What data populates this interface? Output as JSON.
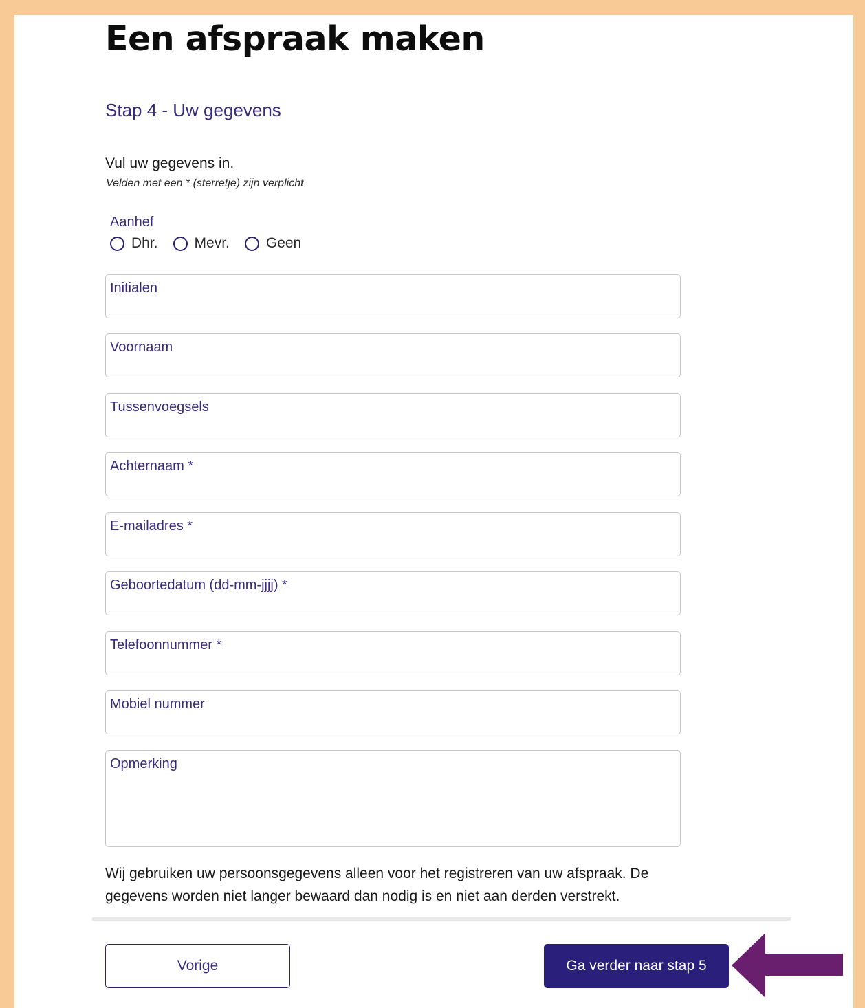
{
  "page": {
    "title": "Een afspraak maken"
  },
  "step": {
    "title": "Stap 4 - Uw gegevens"
  },
  "form": {
    "intro": "Vul uw gegevens in.",
    "required_note": "Velden met een * (sterretje) zijn verplicht",
    "salutation": {
      "label": "Aanhef",
      "options": [
        "Dhr.",
        "Mevr.",
        "Geen"
      ],
      "selected": null
    },
    "fields": {
      "initials": "Initialen",
      "first_name": "Voornaam",
      "infix": "Tussenvoegsels",
      "last_name": "Achternaam *",
      "email": "E-mailadres *",
      "birthdate": "Geboortedatum (dd-mm-jjjj) *",
      "phone": "Telefoonnummer *",
      "mobile": "Mobiel nummer",
      "remark": "Opmerking"
    },
    "privacy_text": "Wij gebruiken uw persoonsgegevens alleen voor het registreren van uw afspraak. De gegevens worden niet langer bewaard dan nodig is en niet aan derden verstrekt."
  },
  "buttons": {
    "previous": "Vorige",
    "next": "Ga verder naar stap 5"
  },
  "colors": {
    "frame_border": "#f8ca95",
    "accent": "#2a1f7a",
    "label": "#3a2b7c",
    "arrow": "#6a1f6e"
  },
  "icons": {
    "annotation": "arrow-left-icon"
  }
}
